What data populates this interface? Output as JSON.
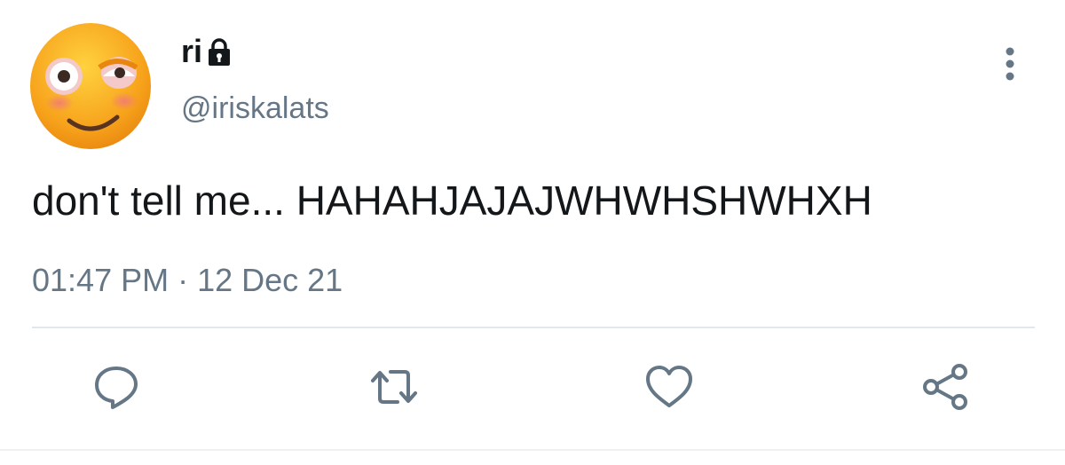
{
  "user": {
    "display_name": "ri",
    "handle": "@iriskalats",
    "avatar_icon": "flushed-face-emoji",
    "locked_icon": "lock-icon"
  },
  "tweet": {
    "text": "don't tell me... HAHAHJAJAJWHWHSHWHXH",
    "timestamp": "01:47 PM · 12 Dec 21"
  },
  "actions": [
    {
      "icon": "reply-icon"
    },
    {
      "icon": "retweet-icon"
    },
    {
      "icon": "like-icon"
    },
    {
      "icon": "share-icon"
    }
  ],
  "menu": {
    "icon": "more-vertical-icon"
  },
  "colors": {
    "text_primary": "#14171a",
    "text_secondary": "#657786",
    "icon_gray": "#657786",
    "divider": "#e1e8ed"
  }
}
